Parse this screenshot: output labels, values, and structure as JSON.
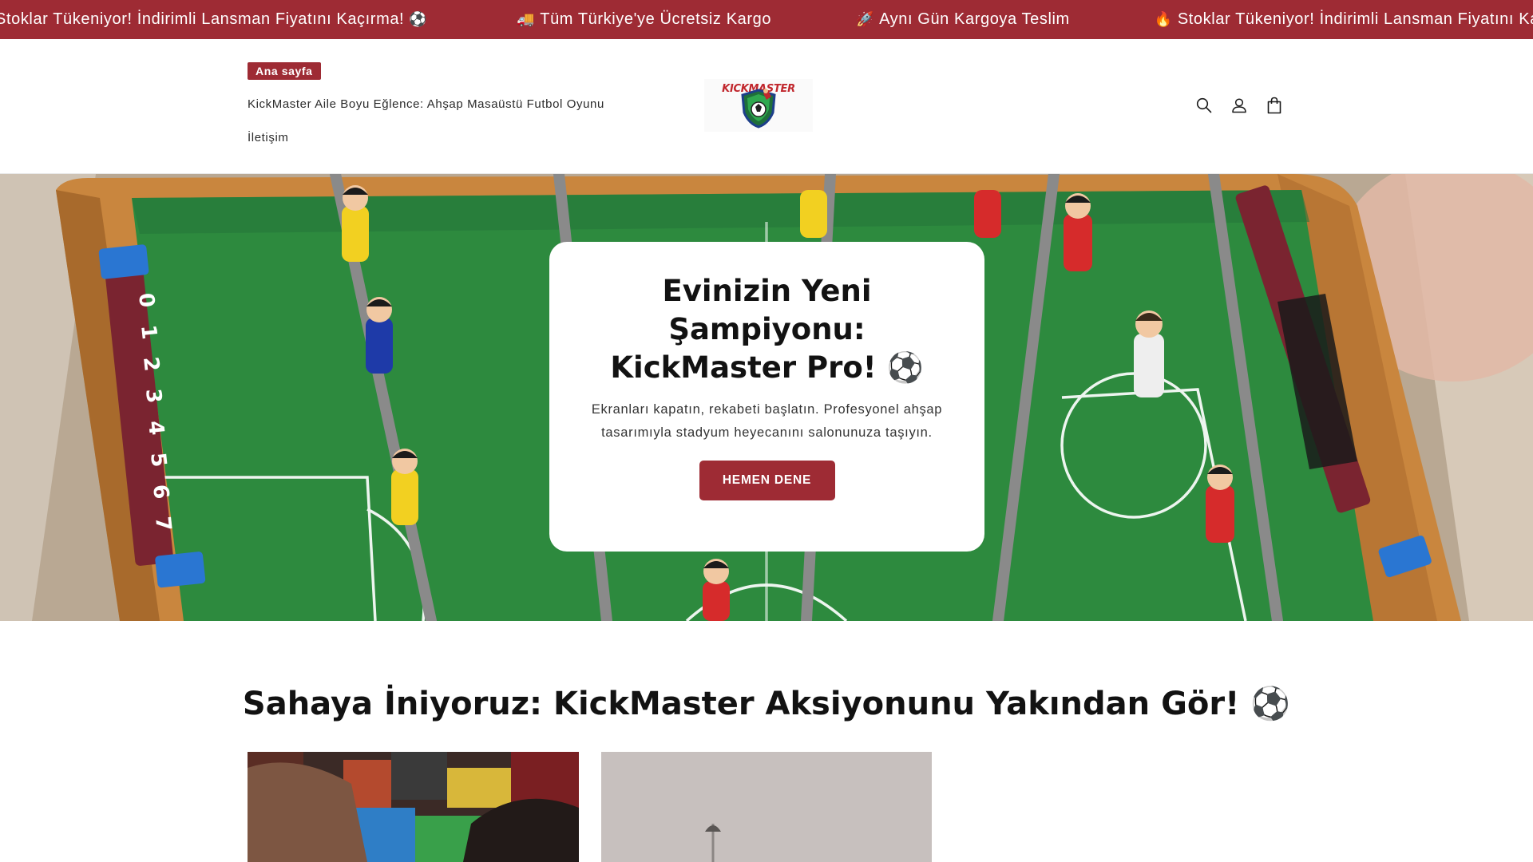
{
  "announcement": {
    "items": [
      {
        "text": "Stoklar Tükeniyor! İndirimli Lansman Fiyatını Kaçırma!",
        "emoji_after": "⚽"
      },
      {
        "emoji_before": "🚚",
        "text": "Tüm Türkiye'ye Ücretsiz Kargo"
      },
      {
        "emoji_before": "🚀",
        "text": "Aynı Gün Kargoya Teslim"
      },
      {
        "emoji_before": "🔥",
        "text": "Stoklar Tükeniyor! İndirimli Lansman Fiyatını Kaçırma!"
      }
    ],
    "background": "#9e2b34"
  },
  "header": {
    "nav": [
      {
        "label": "Ana sayfa",
        "active": true
      },
      {
        "label": "KickMaster Aile Boyu Eğlence: Ahşap Masaüstü Futbol Oyunu",
        "active": false
      },
      {
        "label": "İletişim",
        "active": false
      }
    ],
    "logo_text": "KICKMASTER",
    "icons": [
      "search-icon",
      "account-icon",
      "cart-icon"
    ]
  },
  "hero": {
    "title": "Evinizin Yeni Şampiyonu: KickMaster Pro! ⚽",
    "text": "Ekranları kapatın, rekabeti başlatın. Profesyonel ahşap tasarımıyla stadyum heyecanını salonunuza taşıyın.",
    "button_label": "HEMEN DENE"
  },
  "section": {
    "title": "Sahaya İniyoruz: KickMaster Aksiyonunu Yakından Gör! ⚽"
  },
  "colors": {
    "accent": "#9e2b34",
    "field_green": "#2d8a3e"
  }
}
